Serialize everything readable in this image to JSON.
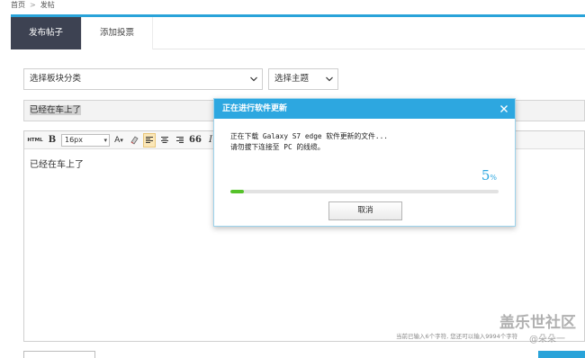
{
  "breadcrumb": {
    "home": "首页",
    "separator": ">",
    "current": "发帖"
  },
  "tabs": [
    {
      "label": "发布帖子",
      "active": true
    },
    {
      "label": "添加投票",
      "active": false
    }
  ],
  "selects": {
    "category": "选择板块分类",
    "topic": "选择主题"
  },
  "post_title": "已经在车上了",
  "toolbar": {
    "html": "HTML",
    "bold": "B",
    "font_size": "16px",
    "font_color": "A",
    "quote": "66",
    "italic": "I"
  },
  "editor_body": "已经在车上了",
  "char_counter": "当前已输入6个字符, 您还可以输入9994个字符",
  "watermark": {
    "main": "盖乐世社区",
    "sub": "@朵朵一"
  },
  "dialog": {
    "title": "正在进行软件更新",
    "line1": "正在下载 Galaxy S7 edge 软件更新的文件...",
    "line2": "请勿拔下连接至 PC 的线缆。",
    "percent_value": "5",
    "percent_sign": "%",
    "progress": 0.05,
    "cancel_label": "取消"
  },
  "colors": {
    "accent": "#2da7e0",
    "progress": "#55c22a",
    "active_tab": "#3d4252"
  }
}
